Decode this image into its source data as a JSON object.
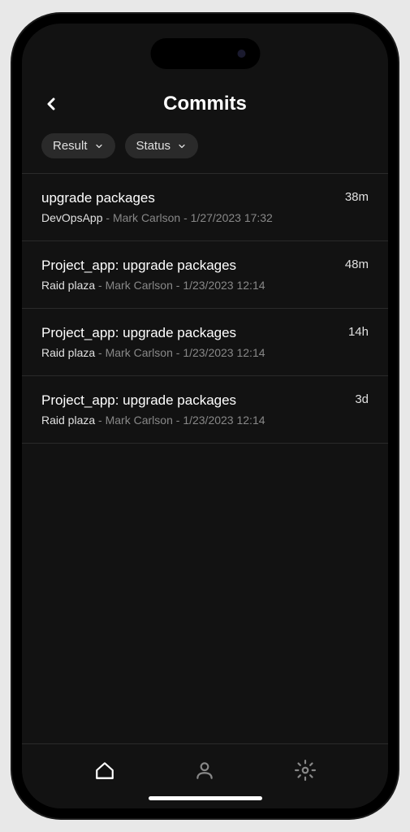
{
  "header": {
    "title": "Commits"
  },
  "filters": [
    {
      "label": "Result"
    },
    {
      "label": "Status"
    }
  ],
  "commits": [
    {
      "title": "upgrade packages",
      "project": "DevOpsApp",
      "author": "Mark Carlson",
      "timestamp": "1/27/2023 17:32",
      "age": "38m"
    },
    {
      "title": "Project_app: upgrade packages",
      "project": "Raid plaza",
      "author": "Mark Carlson",
      "timestamp": "1/23/2023 12:14",
      "age": "48m"
    },
    {
      "title": "Project_app: upgrade packages",
      "project": "Raid plaza",
      "author": "Mark Carlson",
      "timestamp": "1/23/2023 12:14",
      "age": "14h"
    },
    {
      "title": "Project_app: upgrade packages",
      "project": "Raid plaza",
      "author": "Mark Carlson",
      "timestamp": "1/23/2023 12:14",
      "age": "3d"
    }
  ]
}
